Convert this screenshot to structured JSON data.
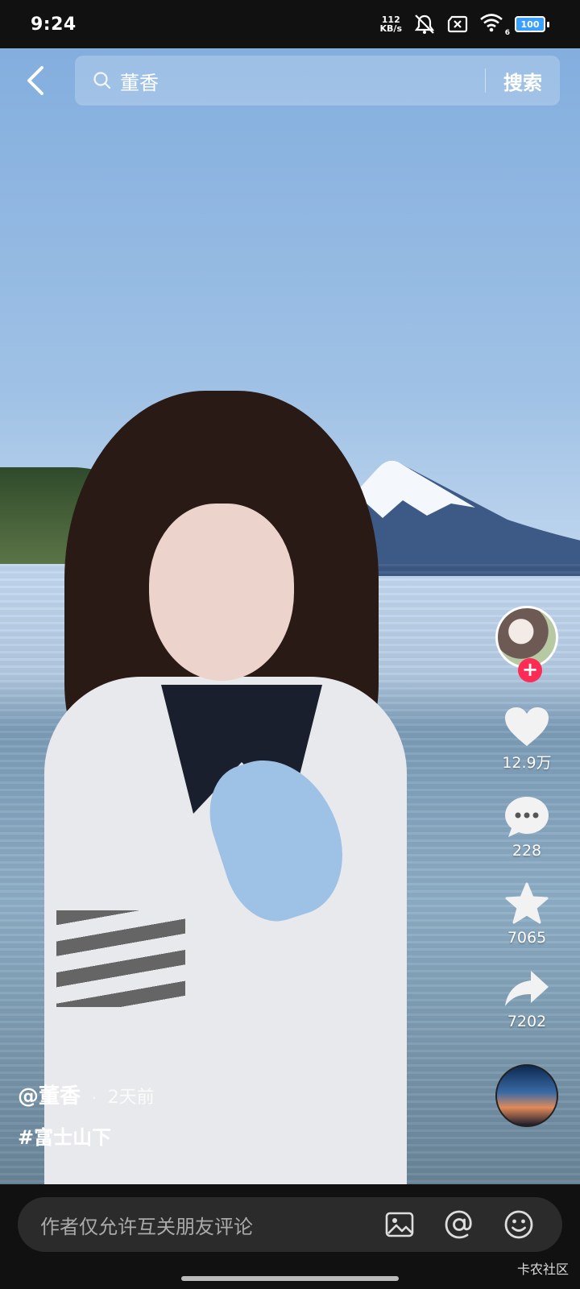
{
  "status_bar": {
    "time": "9:24",
    "net_speed_value": "112",
    "net_speed_unit": "KB/s",
    "wifi_level": "6",
    "battery": "100",
    "icons": [
      "mute-icon",
      "sim-error-icon",
      "wifi-icon",
      "battery-icon"
    ]
  },
  "search": {
    "query": "董香",
    "button_label": "搜索"
  },
  "author": {
    "handle": "@董香",
    "separator": "·",
    "posted": "2天前"
  },
  "caption": {
    "hashtag": "#富士山下"
  },
  "actions": {
    "follow_symbol": "+",
    "likes": "12.9万",
    "comments": "228",
    "favorites": "7065",
    "shares": "7202"
  },
  "comment_bar": {
    "placeholder": "作者仅允许互关朋友评论",
    "icons": [
      "image-icon",
      "at-icon",
      "emoji-icon"
    ]
  },
  "watermark": "卡农社区",
  "colors": {
    "follow_accent": "#fe2c55",
    "battery_fill": "#3aa0ff"
  }
}
